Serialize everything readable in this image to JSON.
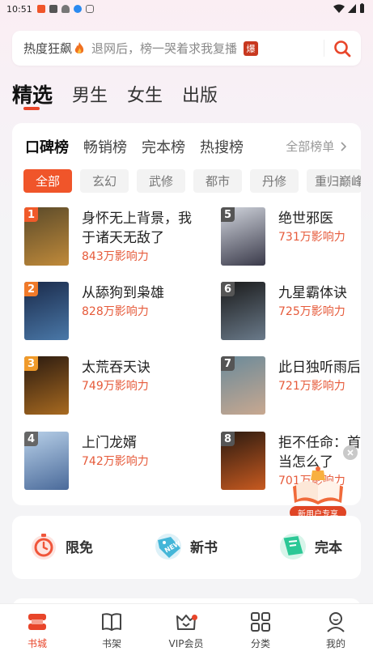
{
  "status_bar": {
    "time": "10:51"
  },
  "search": {
    "hot_label": "热度狂飙",
    "placeholder": "退网后，榜一哭着求我复播",
    "badge": "爆"
  },
  "main_tabs": [
    {
      "label": "精选",
      "active": true
    },
    {
      "label": "男生",
      "active": false
    },
    {
      "label": "女生",
      "active": false
    },
    {
      "label": "出版",
      "active": false
    }
  ],
  "rank_tabs": [
    {
      "label": "口碑榜",
      "active": true
    },
    {
      "label": "畅销榜",
      "active": false
    },
    {
      "label": "完本榜",
      "active": false
    },
    {
      "label": "热搜榜",
      "active": false
    }
  ],
  "all_ranks_label": "全部榜单",
  "categories": [
    "全部",
    "玄幻",
    "武修",
    "都市",
    "丹修",
    "重归巅峰"
  ],
  "books": [
    {
      "rank": "1",
      "title": "身怀无上背景，我于诸天无敌了",
      "heat": "843万影响力",
      "badge_color": "#f05a2a",
      "cover_colors": [
        "#5a4a2a",
        "#c08a3a"
      ]
    },
    {
      "rank": "2",
      "title": "从舔狗到枭雄",
      "heat": "828万影响力",
      "badge_color": "#f07a2a",
      "cover_colors": [
        "#1a2a4a",
        "#4a78a8"
      ]
    },
    {
      "rank": "3",
      "title": "太荒吞天诀",
      "heat": "749万影响力",
      "badge_color": "#f09a2a",
      "cover_colors": [
        "#2a1a10",
        "#a86a20"
      ]
    },
    {
      "rank": "4",
      "title": "上门龙婿",
      "heat": "742万影响力",
      "badge_color": "#666666",
      "cover_colors": [
        "#b8d0e8",
        "#4a6a9a"
      ]
    },
    {
      "rank": "5",
      "title": "绝世邪医",
      "heat": "731万影响力",
      "badge_color": "#555555",
      "cover_colors": [
        "#d0d4dc",
        "#3a3a4a"
      ]
    },
    {
      "rank": "6",
      "title": "九星霸体诀",
      "heat": "725万影响力",
      "badge_color": "#555555",
      "cover_colors": [
        "#1a1a1a",
        "#6a7a8a"
      ]
    },
    {
      "rank": "7",
      "title": "此日独听雨后",
      "heat": "721万影响力",
      "badge_color": "#555555",
      "cover_colors": [
        "#6a8a9a",
        "#c8a890"
      ]
    },
    {
      "rank": "8",
      "title": "拒不任命：首当怎么了",
      "heat": "701万影响力",
      "badge_color": "#555555",
      "cover_colors": [
        "#2a1a10",
        "#c85a20"
      ]
    }
  ],
  "promo": {
    "label": "新用户专享"
  },
  "quick_entries": [
    {
      "label": "限免",
      "icon": "stopwatch-icon"
    },
    {
      "label": "新书",
      "icon": "new-tag-icon"
    },
    {
      "label": "完本",
      "icon": "book-complete-icon"
    }
  ],
  "bottom_nav": [
    {
      "label": "书城",
      "icon": "bookstore-icon",
      "active": true
    },
    {
      "label": "书架",
      "icon": "open-book-icon",
      "active": false
    },
    {
      "label": "VIP会员",
      "icon": "vip-crown-icon",
      "active": false
    },
    {
      "label": "分类",
      "icon": "grid-icon",
      "active": false
    },
    {
      "label": "我的",
      "icon": "user-icon",
      "active": false
    }
  ],
  "colors": {
    "accent": "#e8452a",
    "heat_text": "#e65a3a"
  }
}
